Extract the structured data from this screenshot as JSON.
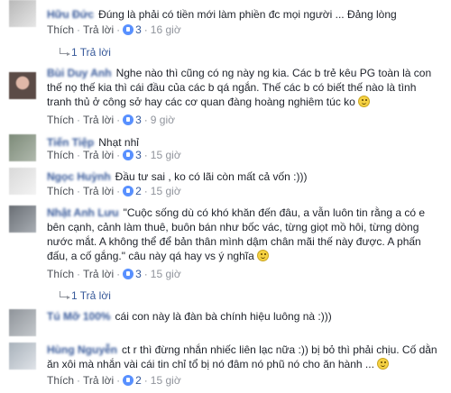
{
  "labels": {
    "like": "Thích",
    "reply": "Trả lời",
    "separator": "·"
  },
  "comments": [
    {
      "name": "Hữu Đức",
      "text": "Đúng là phải có tiền mới làm phiền đc mọi người ... Đảng lòng",
      "likes": "3",
      "time": "16 giờ",
      "replies": "1 Trả lời",
      "emoji": false
    },
    {
      "name": "Bùi Duy Anh",
      "text": "Nghe nào thì cũng có ng này ng kia. Các b trẻ kêu PG toàn là con thế nọ thế kia thì cái đầu của các b qá ngắn. Thế các b có biết thế nào là tình tranh thủ ở công sở hay các cơ quan đàng hoàng nghiêm túc ko",
      "likes": "3",
      "time": "9 giờ",
      "emoji": true
    },
    {
      "name": "Tiến Tiệp",
      "text": "Nhạt nhỉ",
      "likes": "3",
      "time": "15 giờ",
      "emoji": false
    },
    {
      "name": "Ngọc Huỳnh",
      "text": "Đầu tư sai , ko có lãi còn mất cả vốn :)))",
      "likes": "2",
      "time": "15 giờ",
      "emoji": false
    },
    {
      "name": "Nhật Anh Lưu",
      "text": "\"Cuộc sống dù có khó khăn đến đâu, a vẫn luôn tin rằng a có e bên cạnh, cảnh làm thuê, buôn bán như bốc vác, từng giọt mồ hôi, từng dòng nước mắt. A không thể để bản thân mình dậm chân mãi thế này được. A phấn đấu, a cố gắng.\" câu này qá hay vs ý nghĩa",
      "likes": "3",
      "time": "15 giờ",
      "replies": "1 Trả lời",
      "emoji": true
    },
    {
      "name": "Tú Mỡ 100%",
      "text": "cái con này là đàn bà chính hiệu luông nà :)))",
      "likes": "",
      "time": "",
      "emoji": false
    },
    {
      "name": "Hùng Nguyễn",
      "text": "ct r thì đừng nhắn nhiếc liên lạc nữa :)) bị bỏ thì phải chịu. Cố dằn ăn xôi mà nhắn vài cái tin chỉ tổ bị nó đâm nó phũ nó cho ăn hành ...",
      "likes": "2",
      "time": "15 giờ",
      "emoji": true
    }
  ]
}
